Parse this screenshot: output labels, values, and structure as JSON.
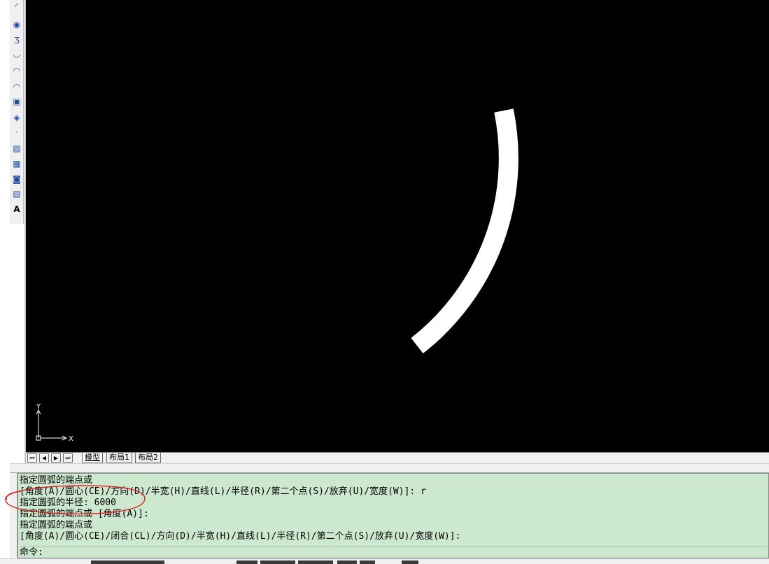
{
  "left_toolbar": {
    "tools": [
      {
        "icon": "arc-tool-icon",
        "glyph": "◜"
      },
      {
        "icon": "circle-tool-icon",
        "glyph": "◉"
      },
      {
        "icon": "revision-cloud-icon",
        "glyph": "Ʒ"
      },
      {
        "icon": "spline-icon",
        "glyph": "◡"
      },
      {
        "icon": "ellipse-icon",
        "glyph": "◠"
      },
      {
        "icon": "ellipse-arc-icon",
        "glyph": "◠"
      },
      {
        "icon": "insert-block-icon",
        "glyph": "▣"
      },
      {
        "icon": "make-block-icon",
        "glyph": "◈"
      },
      {
        "icon": "point-icon",
        "glyph": "·"
      },
      {
        "icon": "hatch-icon",
        "glyph": "▨"
      },
      {
        "icon": "gradient-icon",
        "glyph": "▦"
      },
      {
        "icon": "region-icon",
        "glyph": "◙"
      },
      {
        "icon": "table-icon",
        "glyph": "▤"
      },
      {
        "icon": "multiline-text-icon",
        "glyph": "A"
      }
    ]
  },
  "canvas": {
    "background": "#000000",
    "arc_color": "#ffffff",
    "ucs": {
      "y_label": "Y",
      "x_label": "X"
    }
  },
  "layout_tabs": {
    "nav": [
      "⏮",
      "◀",
      "▶",
      "⏭"
    ],
    "tabs": [
      "模型",
      "布局1",
      "布局2"
    ],
    "active": "模型"
  },
  "command_window": {
    "background": "#cce8cf",
    "history": [
      "指定圆弧的端点或",
      "[角度(A)/圆心(CE)/方向(D)/半宽(H)/直线(L)/半径(R)/第二个点(S)/放弃(U)/宽度(W)]: r",
      "指定圆弧的半径: 6000",
      "指定圆弧的端点或 [角度(A)]:",
      "指定圆弧的端点或",
      "[角度(A)/圆心(CE)/闭合(CL)/方向(D)/半宽(H)/直线(L)/半径(R)/第二个点(S)/放弃(U)/宽度(W)]:"
    ],
    "prompt": "命令:"
  },
  "annotation": {
    "color": "#e02020"
  }
}
